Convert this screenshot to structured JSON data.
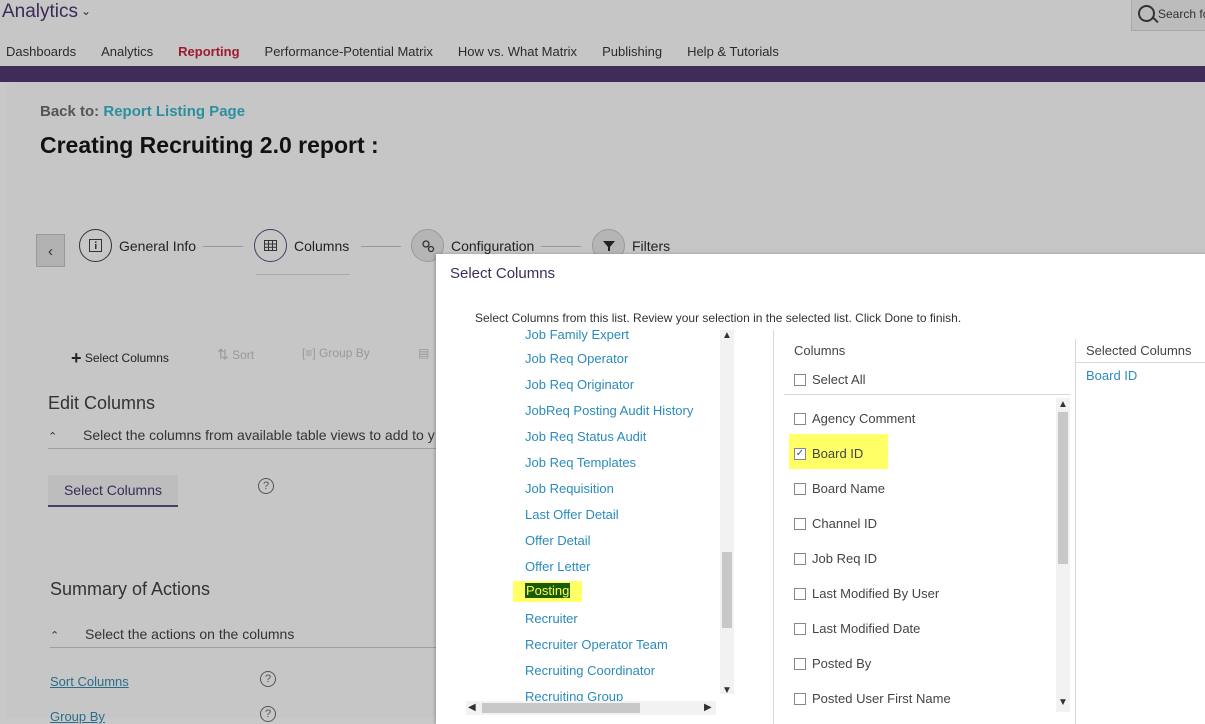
{
  "header": {
    "app_title": "Analytics",
    "search_placeholder": "Search fo",
    "nav": [
      {
        "label": "Dashboards",
        "active": false
      },
      {
        "label": "Analytics",
        "active": false
      },
      {
        "label": "Reporting",
        "active": true
      },
      {
        "label": "Performance-Potential Matrix",
        "active": false
      },
      {
        "label": "How vs. What Matrix",
        "active": false
      },
      {
        "label": "Publishing",
        "active": false
      },
      {
        "label": "Help & Tutorials",
        "active": false
      }
    ]
  },
  "page": {
    "back_prefix": "Back to:",
    "back_link": "Report Listing Page",
    "title": "Creating Recruiting 2.0 report :"
  },
  "steps": [
    {
      "label": "General Info",
      "icon": "info-icon"
    },
    {
      "label": "Columns",
      "icon": "grid-icon"
    },
    {
      "label": "Configuration",
      "icon": "gears-icon"
    },
    {
      "label": "Filters",
      "icon": "filter-icon"
    }
  ],
  "toolbar": {
    "select_columns": "Select Columns",
    "sort": "Sort",
    "group_by": "Group By"
  },
  "edit_columns": {
    "heading": "Edit Columns",
    "subtitle": "Select the columns from available table views to add to y",
    "button": "Select Columns"
  },
  "summary": {
    "heading": "Summary of Actions",
    "subtitle": "Select the actions on the columns",
    "sort_link": "Sort Columns",
    "group_link": "Group By"
  },
  "modal": {
    "title": "Select Columns",
    "instructions": "Select Columns from this list. Review your selection in the selected list. Click Done to finish.",
    "tables": [
      "Job Family Expert",
      "Job Req Operator",
      "Job Req Originator",
      "JobReq Posting Audit History",
      "Job Req Status Audit",
      "Job Req Templates",
      "Job Requisition",
      "Last Offer Detail",
      "Offer Detail",
      "Offer Letter",
      "Posting",
      "Recruiter",
      "Recruiter Operator Team",
      "Recruiting Coordinator",
      "Recruiting Group"
    ],
    "highlighted_table": "Posting",
    "columns_heading": "Columns",
    "select_all": "Select All",
    "columns": [
      {
        "label": "Agency Comment",
        "checked": false
      },
      {
        "label": "Board ID",
        "checked": true
      },
      {
        "label": "Board Name",
        "checked": false
      },
      {
        "label": "Channel ID",
        "checked": false
      },
      {
        "label": "Job Req ID",
        "checked": false
      },
      {
        "label": "Last Modified By User",
        "checked": false
      },
      {
        "label": "Last Modified Date",
        "checked": false
      },
      {
        "label": "Posted By",
        "checked": false
      },
      {
        "label": "Posted User First Name",
        "checked": false
      }
    ],
    "selected_heading": "Selected Columns",
    "selected": [
      "Board ID"
    ]
  }
}
